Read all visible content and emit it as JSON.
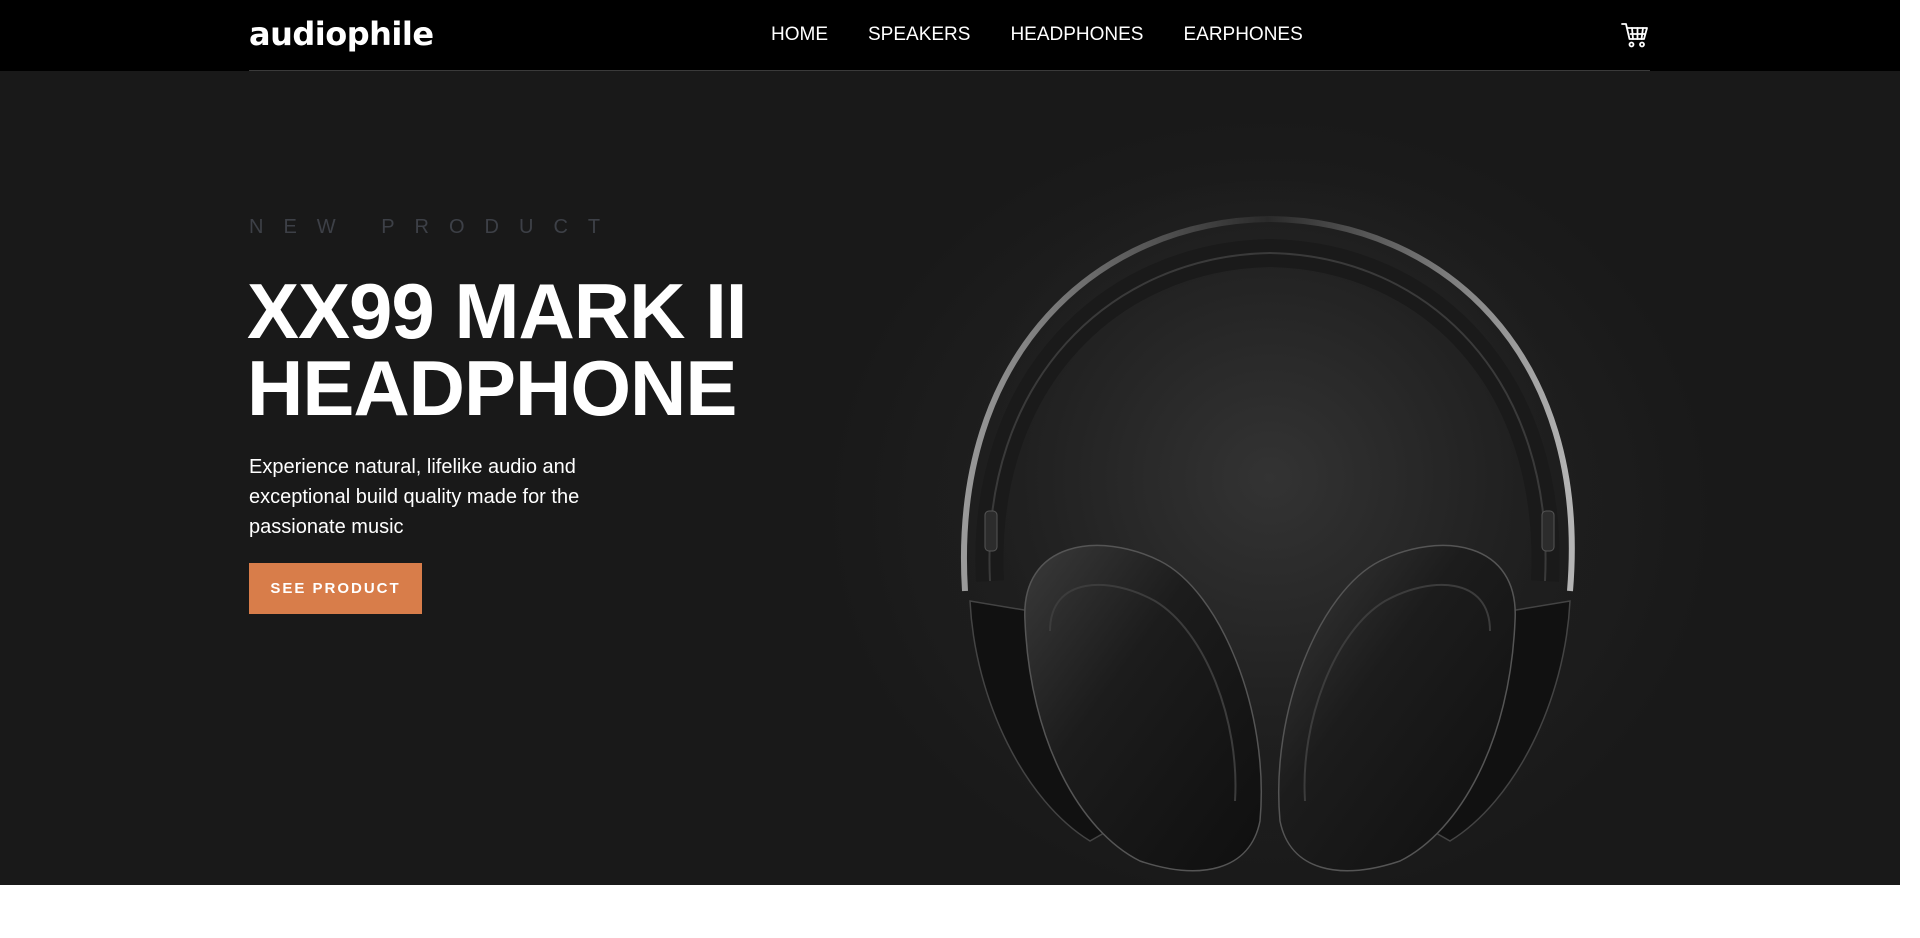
{
  "brand": {
    "logo": "audiophile"
  },
  "nav": {
    "items": [
      {
        "label": "HOME"
      },
      {
        "label": "SPEAKERS"
      },
      {
        "label": "HEADPHONES"
      },
      {
        "label": "EARPHONES"
      }
    ],
    "cart_icon": "cart-icon"
  },
  "hero": {
    "overline": "NEW PRODUCT",
    "title_line1": "XX99 MARK II",
    "title_line2": "HEADPHONE",
    "description": "Experience natural, lifelike audio and exceptional build quality made for the passionate music",
    "cta_label": "SEE PRODUCT",
    "image_icon": "headphones-image"
  },
  "colors": {
    "header_bg": "#000000",
    "hero_bg": "#191919",
    "accent": "#d87d4a",
    "overline": "#3d4047",
    "text": "#ffffff"
  }
}
